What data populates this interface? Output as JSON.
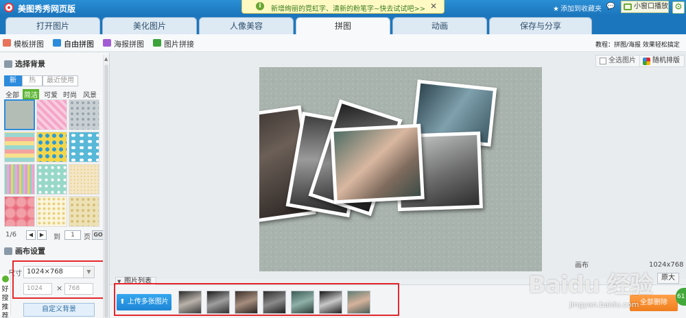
{
  "app": {
    "title": "美图秀秀网页版",
    "notice": "新增绚丽的霓虹字、清新的粉笔字~快去试试吧>>",
    "add_favorite": "添加到收藏夹",
    "mini_window": "小窗口播放"
  },
  "tabs": [
    {
      "label": "打开图片"
    },
    {
      "label": "美化图片"
    },
    {
      "label": "人像美容"
    },
    {
      "label": "拼图"
    },
    {
      "label": "动画"
    },
    {
      "label": "保存与分享"
    }
  ],
  "subtabs": [
    {
      "label": "模板拼图",
      "color": "#e8735a"
    },
    {
      "label": "自由拼图",
      "color": "#2c8bdc"
    },
    {
      "label": "海报拼图",
      "color": "#a25bd4"
    },
    {
      "label": "图片拼接",
      "color": "#3aa33a"
    }
  ],
  "tips": "教程：拼图/海报 效果轻松搞定",
  "left_panel": {
    "bg_section_title": "选择背景",
    "bg_tabs": [
      "新",
      "热",
      "最近使用"
    ],
    "categories": [
      "全部",
      "简洁",
      "可爱",
      "时尚",
      "风景"
    ],
    "pager": {
      "current": "1/6",
      "to_label": "到",
      "page_input": "1",
      "page_label": "页",
      "go": "GO"
    },
    "canvas_section_title": "画布设置",
    "size_label": "尺寸",
    "canvas_size": "1024×768",
    "width_placeholder": "1024",
    "height_placeholder": "768",
    "times": "×",
    "custom_bg": "自定义背景",
    "recommend": "好搜推荐"
  },
  "workspace": {
    "select_all": "全选图片",
    "random_layout": "随机排版",
    "zoom_label": "画布",
    "canvas_dims": "1024x768",
    "original": "原大"
  },
  "strip": {
    "label": "图片列表",
    "upload": "上传多张图片",
    "delete_all": "全部删除",
    "badge": "61"
  },
  "watermark": {
    "brand": "Baidu 经验",
    "url": "jingyan.baidu.com"
  },
  "colors": {
    "brand_blue": "#1c76bd",
    "highlight_red": "#e5262b",
    "upload_blue": "#2c8bdc",
    "delete_orange": "#f07e1c",
    "accent_green": "#5bb531"
  }
}
